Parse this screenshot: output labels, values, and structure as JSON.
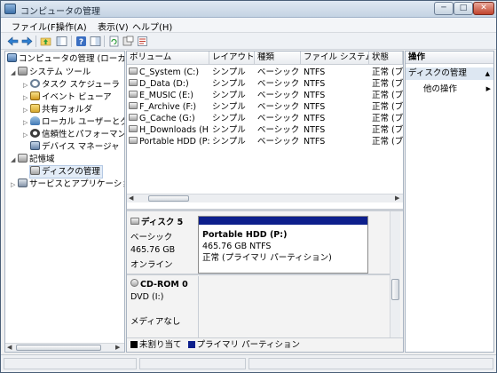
{
  "window": {
    "title": "コンピュータの管理"
  },
  "title_buttons": {
    "minimize": "─",
    "maximize": "□",
    "close": "✕"
  },
  "menu": [
    "ファイル(F)",
    "操作(A)",
    "表示(V)",
    "ヘルプ(H)"
  ],
  "toolbar_icons": [
    "back-icon",
    "forward-icon",
    "up-folder-icon",
    "show-tree-icon",
    "help-icon",
    "view-icon",
    "refresh-icon",
    "export-icon",
    "properties-icon"
  ],
  "tree": {
    "root": "コンピュータの管理 (ローカル)",
    "system_tools": "システム ツール",
    "task_scheduler": "タスク スケジューラ",
    "event_viewer": "イベント ビューア",
    "shared_folders": "共有フォルダ",
    "local_users": "ローカル ユーザーとグループ",
    "reliability": "信頼性とパフォーマンス",
    "device_manager": "デバイス マネージャ",
    "storage": "記憶域",
    "disk_management": "ディスクの管理",
    "services_apps": "サービスとアプリケーション"
  },
  "volume_list": {
    "columns": [
      "ボリューム",
      "レイアウト",
      "種類",
      "ファイル システム",
      "状態"
    ],
    "rows": [
      {
        "volume": "C_System (C:)",
        "layout": "シンプル",
        "type": "ベーシック",
        "fs": "NTFS",
        "status": "正常 (ブ"
      },
      {
        "volume": "D_Data (D:)",
        "layout": "シンプル",
        "type": "ベーシック",
        "fs": "NTFS",
        "status": "正常 (ブ"
      },
      {
        "volume": "E_MUSIC (E:)",
        "layout": "シンプル",
        "type": "ベーシック",
        "fs": "NTFS",
        "status": "正常 (ブ"
      },
      {
        "volume": "F_Archive (F:)",
        "layout": "シンプル",
        "type": "ベーシック",
        "fs": "NTFS",
        "status": "正常 (ブ"
      },
      {
        "volume": "G_Cache (G:)",
        "layout": "シンプル",
        "type": "ベーシック",
        "fs": "NTFS",
        "status": "正常 (ブ"
      },
      {
        "volume": "H_Downloads (H:)",
        "layout": "シンプル",
        "type": "ベーシック",
        "fs": "NTFS",
        "status": "正常 (ブ"
      },
      {
        "volume": "Portable HDD (P:)",
        "layout": "シンプル",
        "type": "ベーシック",
        "fs": "NTFS",
        "status": "正常 (ブ"
      }
    ]
  },
  "disk5": {
    "title": "ディスク 5",
    "type": "ベーシック",
    "size": "465.76 GB",
    "state": "オンライン",
    "partition": {
      "name": "Portable HDD  (P:)",
      "size_fs": "465.76 GB NTFS",
      "status": "正常 (プライマリ パーティション)"
    }
  },
  "cdrom0": {
    "title": "CD-ROM 0",
    "drive": "DVD (I:)",
    "media": "メディアなし"
  },
  "legend": {
    "unallocated": "未割り当て",
    "primary": "プライマリ パーティション"
  },
  "actions": {
    "header": "操作",
    "section": "ディスクの管理",
    "other": "他の操作"
  },
  "colors": {
    "primary_partition": "#0d1f8c",
    "unallocated": "#000000"
  }
}
